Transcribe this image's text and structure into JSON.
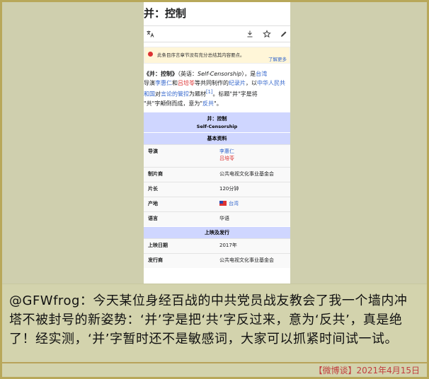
{
  "header": {
    "title": "并：控制"
  },
  "notice": {
    "text": "此条目序言章节没有充分总结其内容要点。",
    "more": "了解更多"
  },
  "intro": {
    "title_bold": "《并：控制》",
    "paren_prefix": "（英语：",
    "english": "Self-Censorship",
    "paren_suffix": "），是",
    "taiwan": "台湾",
    "line2_prefix": "导演",
    "director1": "李惠仁",
    "and": "和",
    "director2": "吕培苓",
    "line2_mid": "等共同制作的",
    "documentary": "纪录片",
    "line2_suffix": "，以",
    "prc": "中华人民共和国",
    "line3_mid": "对",
    "speech_control": "言论的管控",
    "line3_suffix": "为题材",
    "ref": "[1]",
    "line3_end": "。标题\"并\"字是将",
    "line4_prefix": "\"共\"字颠倒而成，意为\"",
    "anti_communist": "反共",
    "line4_suffix": "\"。"
  },
  "infobox": {
    "title": "并：控制",
    "subtitle": "Self-Censorship",
    "section_basic": "基本资料",
    "rows": [
      {
        "k": "导演",
        "v": [
          "李惠仁",
          "吕培苓"
        ]
      },
      {
        "k": "制片商",
        "v": [
          "公共电视文化事业基金会"
        ]
      },
      {
        "k": "片长",
        "v": [
          "120分钟"
        ]
      },
      {
        "k": "产地",
        "v": [
          "台湾"
        ]
      },
      {
        "k": "语言",
        "v": [
          "华语"
        ]
      }
    ],
    "section_release": "上映及发行",
    "release_rows": [
      {
        "k": "上映日期",
        "v": "2017年"
      },
      {
        "k": "发行商",
        "v": "公共电视文化事业基金会"
      }
    ]
  },
  "caption": {
    "text": "@GFWfrog：今天某位身经百战的中共党员战友教会了我一个墙内冲塔不被封号的新姿势：‘并’字是把‘共’字反过来，意为‘反共’，真是绝了！经实测，‘并’字暂时还不是敏感词，大家可以抓紧时间试一试。"
  },
  "footer": {
    "text": "【微博谈】2021年4月15日"
  },
  "icons": {
    "translate": "translate-icon",
    "download": "download-icon",
    "star": "star-icon",
    "edit": "pencil-icon",
    "notice": "notice-icon",
    "flag": "taiwan-flag-icon"
  },
  "colors": {
    "link": "#3366cc",
    "red_link": "#dd3333",
    "infobox_header": "#cfd6ff",
    "caption_bg": "#d3d3ad",
    "footer_text": "#c13f3f",
    "frame_border": "#b8a85a"
  }
}
